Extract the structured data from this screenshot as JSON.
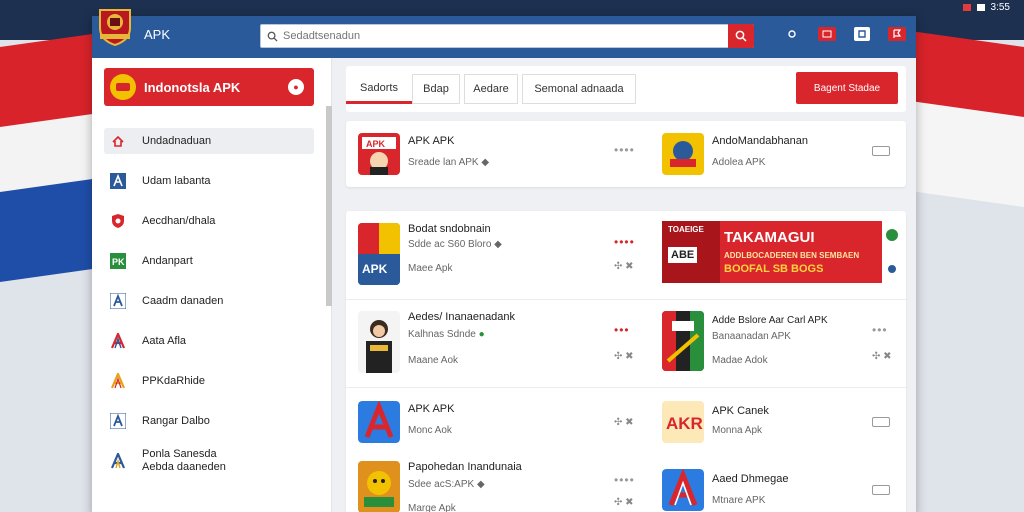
{
  "window": {
    "title": "APK"
  },
  "status_bar": {
    "time": "3:55"
  },
  "search": {
    "placeholder": "Sedadtsenadun"
  },
  "sidebar": {
    "brand_title": "Indonotsla APK",
    "items": [
      {
        "label": "Undadnaduan",
        "icon": "home-icon"
      },
      {
        "label": "Udam labanta",
        "icon": "apk-icon"
      },
      {
        "label": "Aecdhan/dhala",
        "icon": "shield-icon"
      },
      {
        "label": "Andanpart",
        "icon": "flag-icon"
      },
      {
        "label": "Caadm danaden",
        "icon": "apk-icon"
      },
      {
        "label": "Aata Afla",
        "icon": "apk-icon"
      },
      {
        "label": "PPKdaRhide",
        "icon": "apk-icon"
      },
      {
        "label": "Rangar Dalbo",
        "icon": "apk-icon"
      },
      {
        "label": "Ponla Sanesda",
        "label2": "Aebda daaneden",
        "icon": "apk-icon"
      }
    ]
  },
  "tabs": [
    {
      "label": "Sadorts",
      "active": true
    },
    {
      "label": "Bdap",
      "active": false
    },
    {
      "label": "Aedare",
      "active": false
    },
    {
      "label": "Semonal adnaada",
      "active": false
    }
  ],
  "primary_button": {
    "label": "Bagent Stadae"
  },
  "apps": {
    "r1_left": {
      "name": "APK APK",
      "sub": "Sreade lan APK"
    },
    "r1_right": {
      "name": "AndoMandabhanan",
      "sub": "Adolea APK"
    },
    "r2_left": {
      "name": "Bodat sndobnain",
      "sub": "Sdde ac S60 Bloro",
      "sub2": "Maee Apk"
    },
    "r2_banner": {
      "tag": "TOAEIGE",
      "tag2": "ABE",
      "title": "TAKAMAGUI",
      "sub1": "ADDLBOCADEREN BEN SEMBAEN",
      "sub2": "BOOFAL SB BOGS"
    },
    "r3_left": {
      "name": "Aedes/ Inanaenadank",
      "sub": "Kalhnas Sdnde",
      "sub2": "Maane Aok"
    },
    "r3_right": {
      "name": "Adde Bslore Aar Carl APK",
      "sub": "Banaanadan APK",
      "sub2": "Madae Adok"
    },
    "r4_left": {
      "name": "APK APK",
      "sub": "Monc Aok"
    },
    "r4_right": {
      "name": "APK Canek",
      "sub": "Monna Apk"
    },
    "r5_left": {
      "name": "Papohedan Inandunaia",
      "sub": "Sdee acS:APK",
      "sub2": "Marge Apk"
    },
    "r5_right": {
      "name": "Aaed Dhmegae",
      "sub": "Mtnare APK"
    }
  },
  "colors": {
    "accent": "#d9262c",
    "titlebar": "#2b5a9b"
  }
}
